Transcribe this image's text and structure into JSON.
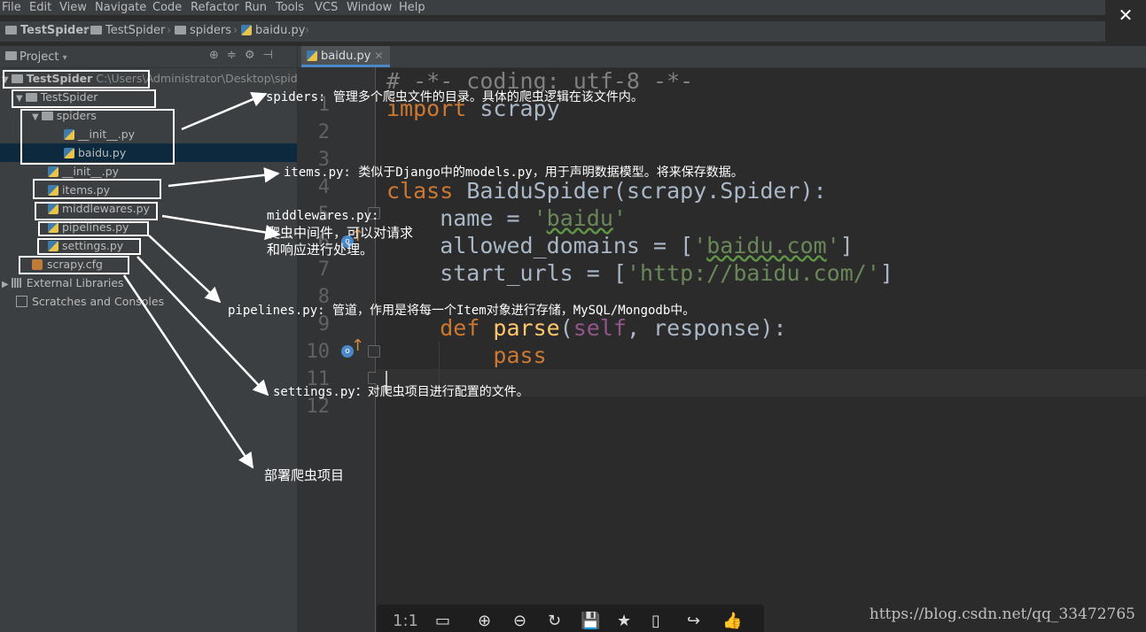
{
  "menu": [
    "File",
    "Edit",
    "View",
    "Navigate",
    "Code",
    "Refactor",
    "Run",
    "Tools",
    "VCS",
    "Window",
    "Help"
  ],
  "window": {
    "close_glyph": "✕"
  },
  "breadcrumb": [
    "TestSpider",
    "TestSpider",
    "spiders",
    "baidu.py"
  ],
  "project_panel": {
    "title": "Project",
    "tree": [
      {
        "label": "TestSpider",
        "path": "C:\\Users\\Administrator\\Desktop\\spider"
      },
      {
        "label": "TestSpider"
      },
      {
        "label": "spiders"
      },
      {
        "label": "__init__.py"
      },
      {
        "label": "baidu.py"
      },
      {
        "label": "__init__.py"
      },
      {
        "label": "items.py"
      },
      {
        "label": "middlewares.py"
      },
      {
        "label": "pipelines.py"
      },
      {
        "label": "settings.py"
      },
      {
        "label": "scrapy.cfg"
      },
      {
        "label": "External Libraries"
      },
      {
        "label": "Scratches and Consoles"
      }
    ]
  },
  "editor": {
    "tab_label": "baidu.py",
    "line_numbers": [
      "1",
      "2",
      "3",
      "4",
      "5",
      "6",
      "7",
      "8",
      "9",
      "10",
      "11",
      "12"
    ],
    "code": {
      "l1": "# -*- coding: utf-8 -*-",
      "l2_kw": "import",
      "l2_rest": " scrapy",
      "l5_kw": "class",
      "l5_name": " BaiduSpider",
      "l5_rest": "(scrapy.Spider):",
      "l6_a": "    name = ",
      "l6_q1": "'",
      "l6_s": "baidu",
      "l6_q2": "'",
      "l7_a": "    allowed_domains = [",
      "l7_q1": "'",
      "l7_s": "baidu.com",
      "l7_q2": "'",
      "l7_b": "]",
      "l8_a": "    start_urls = [",
      "l8_s": "'http://baidu.com/'",
      "l8_b": "]",
      "l10_kw": "    def",
      "l10_fn": " parse",
      "l10_p": "(",
      "l10_self": "self",
      "l10_rest": ", response):",
      "l11_kw": "        pass"
    }
  },
  "annotations": {
    "spiders": "spiders: 管理多个爬虫文件的目录。具体的爬虫逻辑在该文件内。",
    "items": "items.py: 类似于Django中的models.py，用于声明数据模型。将来保存数据。",
    "middlewares_1": "middlewares.py:",
    "middlewares_2": "爬虫中间件，可以对请求",
    "middlewares_3": "和响应进行处理。",
    "pipelines": "pipelines.py: 管道，作用是将每一个Item对象进行存储，MySQL/Mongodb中。",
    "settings": "settings.py：对爬虫项目进行配置的文件。",
    "cfg": "部署爬虫项目"
  },
  "viewer_toolbar": [
    "1:1",
    "▭",
    "⊕",
    "⊖",
    "↻",
    "💾",
    "★",
    "▯",
    "↪",
    "👍"
  ],
  "watermark": "https://blog.csdn.net/qq_33472765"
}
